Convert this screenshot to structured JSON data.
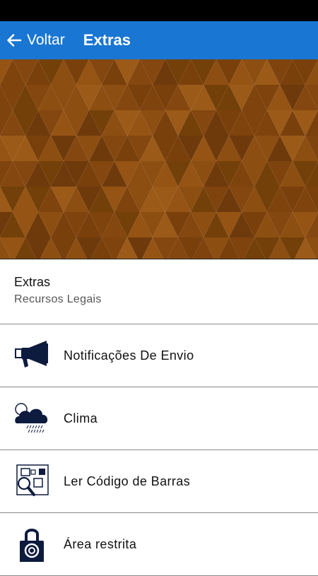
{
  "header": {
    "back_label": "Voltar",
    "title": "Extras",
    "bar_color": "#1976d2"
  },
  "banner": {
    "pattern": "brown-triangle-mosaic",
    "base_color": "#7a400c"
  },
  "section": {
    "title": "Extras",
    "subtitle": "Recursos Legais"
  },
  "menu": {
    "items": [
      {
        "label": "Notificações De Envio",
        "icon": "megaphone-icon"
      },
      {
        "label": "Clima",
        "icon": "weather-cloud-icon"
      },
      {
        "label": "Ler Código de Barras",
        "icon": "barcode-scan-icon"
      },
      {
        "label": "Área restrita",
        "icon": "padlock-icon"
      }
    ]
  },
  "colors": {
    "icon": "#0d1b3e",
    "divider": "#888888"
  }
}
